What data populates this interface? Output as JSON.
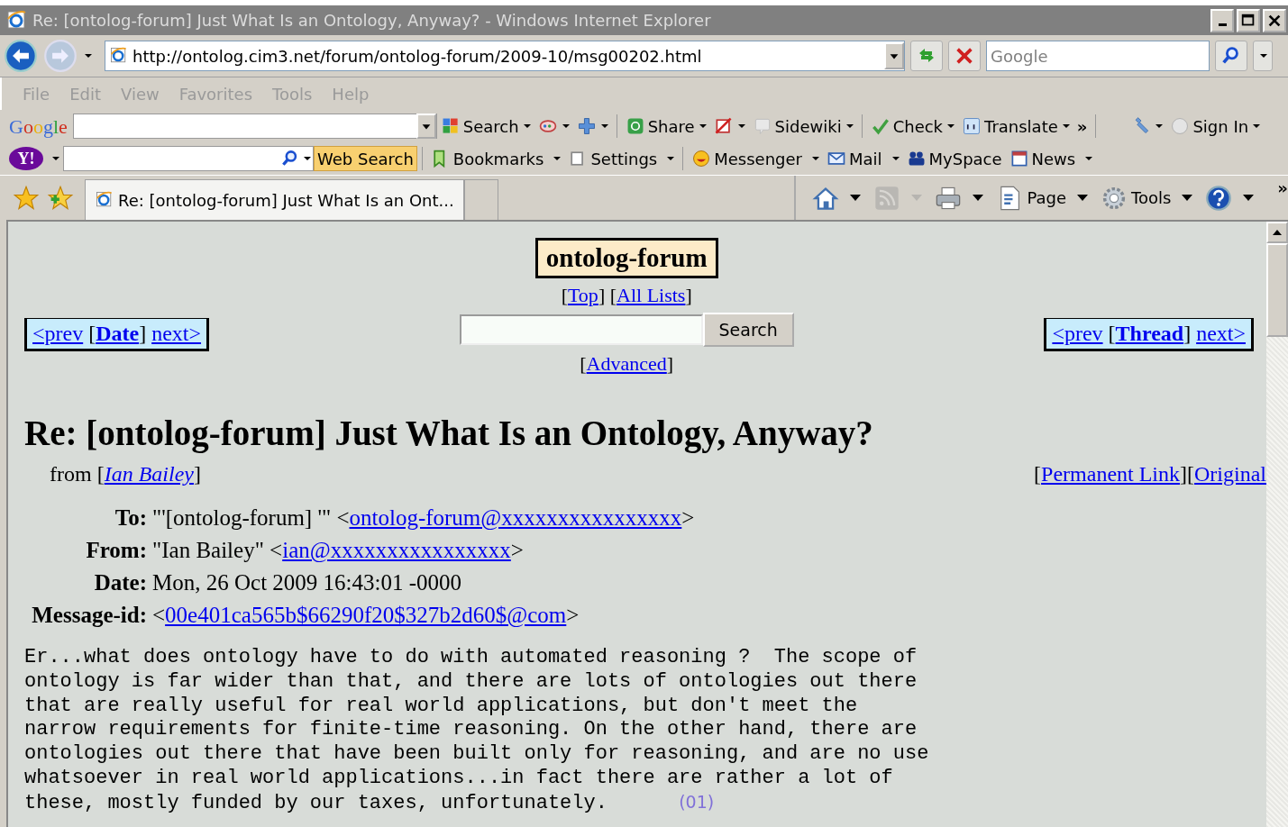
{
  "window": {
    "title": "Re: [ontolog-forum] Just What Is an Ontology, Anyway? - Windows Internet Explorer"
  },
  "address_bar": {
    "url": "http://ontolog.cim3.net/forum/ontolog-forum/2009-10/msg00202.html",
    "search_placeholder": "Google"
  },
  "menu": [
    "File",
    "Edit",
    "View",
    "Favorites",
    "Tools",
    "Help"
  ],
  "google_toolbar": {
    "logo": "Google",
    "items": [
      {
        "label": "Search",
        "dropdown": true
      },
      {
        "dropdown": true
      },
      {
        "dropdown": true
      },
      {
        "label": "Share",
        "dropdown": true
      },
      {
        "dropdown": true
      },
      {
        "label": "Sidewiki",
        "dropdown": true
      },
      {
        "label": "Check",
        "dropdown": true
      },
      {
        "label": "Translate",
        "dropdown": true
      },
      {
        "label": "»",
        "dropdown": false
      },
      {
        "dropdown": true
      },
      {
        "label": "Sign In",
        "dropdown": true
      }
    ]
  },
  "yahoo_toolbar": {
    "logo": "Y!",
    "search_button": "Web Search",
    "items": [
      {
        "label": "Bookmarks",
        "dropdown": true
      },
      {
        "label": "Settings",
        "dropdown": true
      },
      {
        "label": "Messenger",
        "dropdown": true
      },
      {
        "label": "Mail",
        "dropdown": true
      },
      {
        "label": "MySpace",
        "dropdown": false
      },
      {
        "label": "News",
        "dropdown": true
      }
    ]
  },
  "tabs": [
    {
      "label": "Re: [ontolog-forum] Just What Is an Ont...",
      "selected": true
    }
  ],
  "command_bar": {
    "overflow": "»",
    "items": [
      {
        "dropdown": true,
        "disabled": false
      },
      {
        "dropdown": true,
        "disabled": true
      },
      {
        "dropdown": true,
        "disabled": false
      },
      {
        "label": "Page",
        "dropdown": true,
        "disabled": false
      },
      {
        "label": "Tools",
        "dropdown": true,
        "disabled": false
      },
      {
        "dropdown": true,
        "disabled": false
      }
    ]
  },
  "page": {
    "list_name": "ontolog-forum",
    "list_links": [
      {
        "kind": "text",
        "text": "["
      },
      {
        "kind": "link",
        "text": "Top"
      },
      {
        "kind": "text",
        "text": "] ["
      },
      {
        "kind": "link",
        "text": "All Lists"
      },
      {
        "kind": "text",
        "text": "]"
      }
    ],
    "search_button": "Search",
    "advanced": [
      {
        "kind": "text",
        "text": "["
      },
      {
        "kind": "link",
        "text": "Advanced"
      },
      {
        "kind": "text",
        "text": "]"
      }
    ],
    "date_nav": [
      {
        "kind": "link",
        "text": "<prev"
      },
      {
        "kind": "text",
        "text": " ["
      },
      {
        "kind": "bold_link",
        "text": "Date"
      },
      {
        "kind": "text",
        "text": "] "
      },
      {
        "kind": "link",
        "text": "next>"
      }
    ],
    "thread_nav": [
      {
        "kind": "link",
        "text": "<prev"
      },
      {
        "kind": "text",
        "text": " ["
      },
      {
        "kind": "bold_link",
        "text": "Thread"
      },
      {
        "kind": "text",
        "text": "] "
      },
      {
        "kind": "link",
        "text": "next>"
      }
    ],
    "subject": "Re: [ontolog-forum] Just What Is an Ontology, Anyway?",
    "from": [
      {
        "kind": "text",
        "text": "from ["
      },
      {
        "kind": "italic_link",
        "text": "Ian Bailey"
      },
      {
        "kind": "text",
        "text": "]"
      }
    ],
    "permalinks": [
      {
        "kind": "text",
        "text": "["
      },
      {
        "kind": "link",
        "text": "Permanent Link"
      },
      {
        "kind": "text",
        "text": "]["
      },
      {
        "kind": "link",
        "text": "Original"
      }
    ],
    "headers": [
      {
        "label": "To:",
        "value": [
          {
            "kind": "text",
            "text": "\"'[ontolog-forum] '\" <"
          },
          {
            "kind": "link",
            "text": "ontolog-forum@xxxxxxxxxxxxxxxx"
          },
          {
            "kind": "text",
            "text": ">"
          }
        ]
      },
      {
        "label": "From:",
        "value": [
          {
            "kind": "text",
            "text": "\"Ian Bailey\" <"
          },
          {
            "kind": "link",
            "text": "ian@xxxxxxxxxxxxxxxx"
          },
          {
            "kind": "text",
            "text": ">"
          }
        ]
      },
      {
        "label": "Date:",
        "value": [
          {
            "kind": "text",
            "text": "Mon, 26 Oct 2009 16:43:01 -0000"
          }
        ]
      },
      {
        "label": "Message-id:",
        "value": [
          {
            "kind": "text",
            "text": "<"
          },
          {
            "kind": "link",
            "text": "00e401ca565b$66290f20$327b2d60$@com"
          },
          {
            "kind": "text",
            "text": ">"
          }
        ]
      }
    ],
    "body_lines": [
      "Er...what does ontology have to do with automated reasoning ?  The scope of",
      "ontology is far wider than that, and there are lots of ontologies out there",
      "that are really useful for real world applications, but don't meet the",
      "narrow requirements for finite-time reasoning. On the other hand, there are",
      "ontologies out there that have been built only for reasoning, and are no use",
      "whatsoever in real world applications...in fact there are rather a lot of",
      "these, mostly funded by our taxes, unfortunately."
    ],
    "paragraph_marker": "(01)"
  }
}
